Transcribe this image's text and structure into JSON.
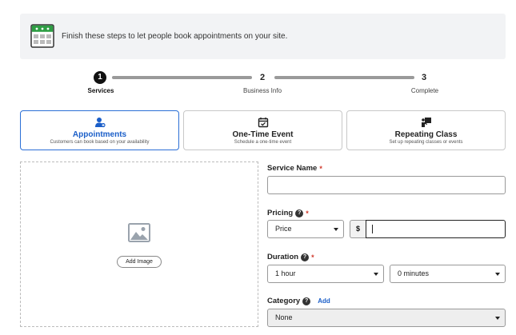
{
  "banner": {
    "text": "Finish these steps to let people book appointments on your site.",
    "icon": "calendar-icon"
  },
  "steps": [
    {
      "number": "1",
      "label": "Services",
      "active": true
    },
    {
      "number": "2",
      "label": "Business Info",
      "active": false
    },
    {
      "number": "3",
      "label": "Complete",
      "active": false
    }
  ],
  "types": [
    {
      "title": "Appointments",
      "subtitle": "Customers can book based on your availability",
      "icon": "person-add-icon",
      "selected": true
    },
    {
      "title": "One-Time Event",
      "subtitle": "Schedule a one-time event",
      "icon": "calendar-check-icon",
      "selected": false
    },
    {
      "title": "Repeating Class",
      "subtitle": "Set up repeating classes or events",
      "icon": "class-board-icon",
      "selected": false
    }
  ],
  "image": {
    "add_label": "Add Image",
    "icon": "image-placeholder-icon"
  },
  "form": {
    "service_name": {
      "label": "Service Name",
      "required": "*",
      "value": ""
    },
    "pricing": {
      "label": "Pricing",
      "required": "*",
      "select_value": "Price",
      "currency": "$",
      "price_value": ""
    },
    "duration": {
      "label": "Duration",
      "required": "*",
      "hours_value": "1 hour",
      "minutes_value": "0 minutes"
    },
    "category": {
      "label": "Category",
      "add_link": "Add",
      "value": "None"
    }
  },
  "colors": {
    "accent": "#2b6fd6",
    "required": "#d0392b",
    "banner_bg": "#f2f3f5",
    "green": "#2e9e44"
  }
}
